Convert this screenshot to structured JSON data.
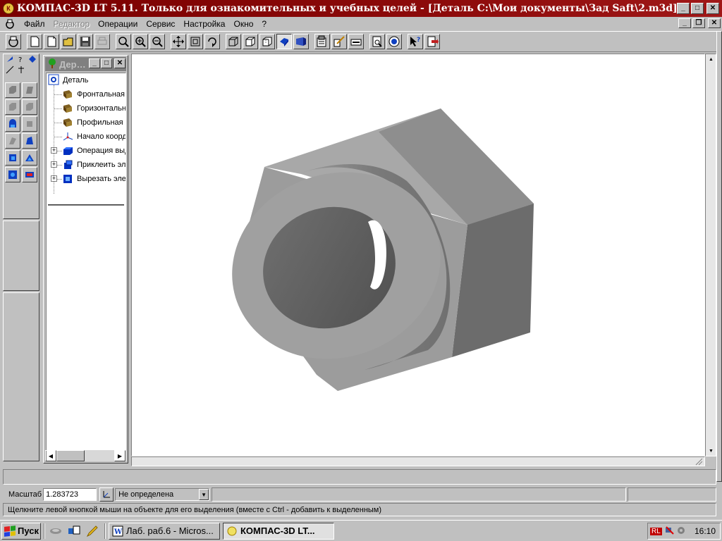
{
  "window": {
    "title": "КОМПАС-3D LT 5.11. Только для ознакомительных и учебных целей - [Деталь C:\\Мои документы\\Зад Saft\\2.m3d]"
  },
  "menu": {
    "items": [
      "Файл",
      "Редактор",
      "Операции",
      "Сервис",
      "Настройка",
      "Окно",
      "?"
    ],
    "disabled": [
      "Редактор"
    ]
  },
  "toolbar": {
    "icons": [
      "new-from-template-icon",
      "new-document-icon",
      "new-sheet-icon",
      "open-icon",
      "save-icon",
      "print-disabled-icon",
      "zoom-window-icon",
      "zoom-in-icon",
      "zoom-out-icon",
      "pan-icon",
      "zoom-to-fit-icon",
      "rotate-icon",
      "wireframe-icon",
      "hidden-lines-icon",
      "hidden-lines-dim-icon",
      "shaded-icon",
      "perspective-icon",
      "parameters-icon",
      "properties-icon",
      "ruler-icon",
      "preview-icon",
      "calculator-icon",
      "help-pointer-icon",
      "exit-icon"
    ]
  },
  "tree": {
    "panel_title": "Дер…",
    "root": "Деталь",
    "items": [
      {
        "label": "Фронтальная",
        "icon": "plane-icon",
        "expandable": false
      },
      {
        "label": "Горизонтальная",
        "icon": "plane-icon",
        "expandable": false
      },
      {
        "label": "Профильная",
        "icon": "plane-icon",
        "expandable": false
      },
      {
        "label": "Начало координат",
        "icon": "origin-icon",
        "expandable": false
      },
      {
        "label": "Операция выдавливания",
        "icon": "extrude-icon",
        "expandable": true
      },
      {
        "label": "Приклеить элемент",
        "icon": "boss-icon",
        "expandable": true
      },
      {
        "label": "Вырезать элемент",
        "icon": "cut-icon",
        "expandable": true
      }
    ]
  },
  "propbar": {
    "scale_label": "Масштаб",
    "scale_value": "1.283723",
    "orientation_value": "Не определена"
  },
  "hint": "Щелкните левой кнопкой мыши на объекте для его выделения (вместе с Ctrl - добавить к выделенным)",
  "taskbar": {
    "start_label": "Пуск",
    "tasks": [
      "Лаб. раб.6 - Micros...",
      "КОМПАС-3D LT..."
    ],
    "active_task": 1,
    "tray_lang": "RL",
    "clock": "16:10"
  },
  "colors": {
    "title_bar": "#7a0000",
    "face_dark": "#6e6e6e",
    "face_mid": "#8a8a8a",
    "face_light": "#a6a6a6"
  }
}
